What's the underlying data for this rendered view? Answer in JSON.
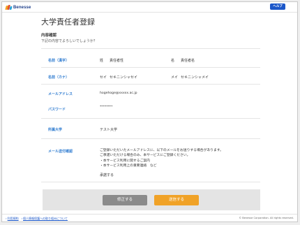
{
  "header": {
    "logo_text": "Benesse",
    "help_label": "ヘルプ"
  },
  "main": {
    "page_title": "大学責任者登録",
    "section_heading": "内容確認",
    "section_sub": "下記の内容でよろしいでしょうか？"
  },
  "fields": {
    "name_kanji": {
      "label": "名前（漢字）",
      "sei_prefix": "姓",
      "sei_value": "責任者性",
      "mei_prefix": "名",
      "mei_value": "責任者名"
    },
    "name_kana": {
      "label": "名前（カナ）",
      "sei_prefix": "セイ",
      "sei_value": "セキニンシャセイ",
      "mei_prefix": "メイ",
      "mei_value": "セキニンシャメイ"
    },
    "email": {
      "label": "メールアドレス",
      "value": "hogehoge@xxxxx.ac.jp"
    },
    "password": {
      "label": "パスワード",
      "value": "********"
    },
    "university": {
      "label": "所属大学",
      "value": "テスト大学"
    },
    "mail_consent": {
      "label": "メール送付確認",
      "lines": [
        "ご登録いただいたメールアドレスに、以下のメールをお送りする場合があります。",
        "ご承諾いただける場合のみ、本サービスにご登録ください。",
        "・本サービス利用に関するご案内",
        "・本サービス利用上の重要連絡　など"
      ],
      "value": "承諾する"
    }
  },
  "actions": {
    "fix_label": "修正する",
    "send_label": "送信する"
  },
  "footer": {
    "links": [
      "利用規約",
      "個人情報保護への取り組みについて"
    ],
    "copyright": "© Benesse Corporation. All rights reserved."
  },
  "colors": {
    "accent_blue": "#1b57c9",
    "label_blue": "#2e7bd0",
    "send_orange": "#f0a227",
    "fix_gray": "#8b8b8b"
  }
}
